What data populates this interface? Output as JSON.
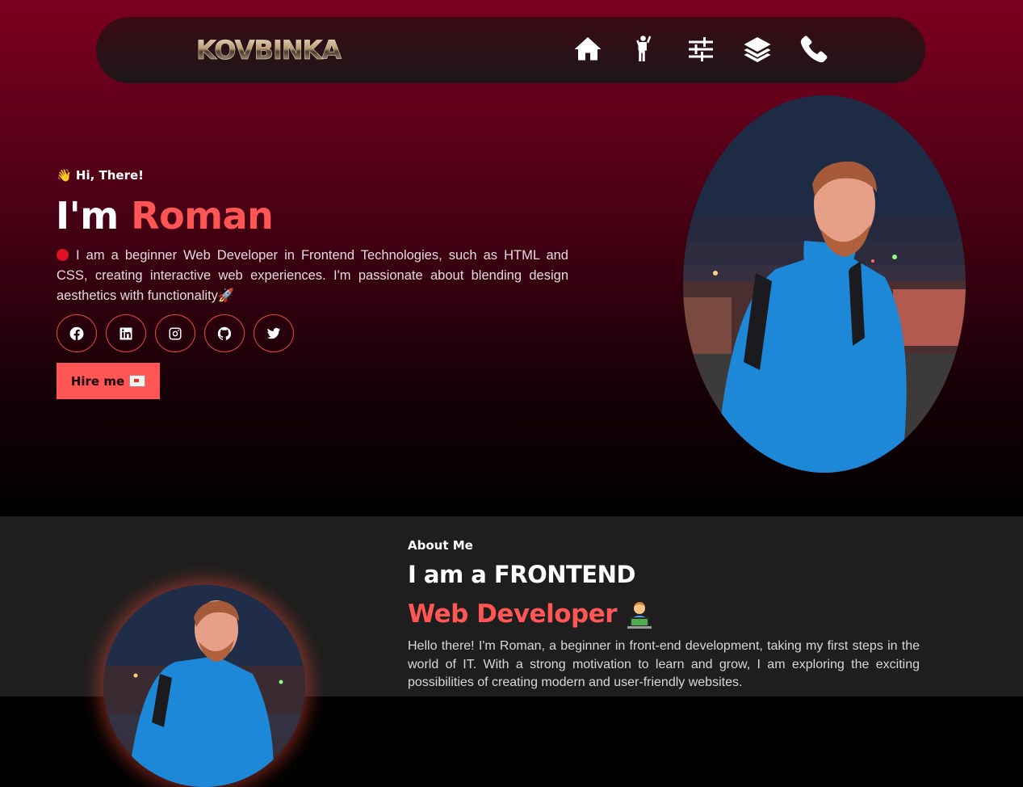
{
  "nav": {
    "logo": "KOVBINKA",
    "icons": [
      "home-icon",
      "person-icon",
      "sliders-icon",
      "layers-icon",
      "phone-icon"
    ]
  },
  "hero": {
    "greeting": "👋 Hi, There!",
    "headline_prefix": "I'm ",
    "headline_name": "Roman",
    "intro": "I am a beginner Web Developer in Frontend Technologies, such as HTML and CSS, creating interactive web experiences. I'm passionate about blending design aesthetics with functionality🚀",
    "socials": [
      "facebook-icon",
      "linkedin-icon",
      "instagram-icon",
      "github-icon",
      "twitter-icon"
    ],
    "hire_label": "Hire me"
  },
  "about": {
    "label": "About Me",
    "title": "I am a FRONTEND",
    "subtitle": "Web Developer",
    "text": "Hello there! I'm Roman, a beginner in front-end development, taking my first steps in the world of IT. With a strong motivation to learn and grow, I am exploring the exciting possibilities of creating modern and user-friendly websites."
  },
  "colors": {
    "accent": "#ff5555",
    "hero_top": "#7c0020",
    "about_bg": "#1e1e1e"
  }
}
